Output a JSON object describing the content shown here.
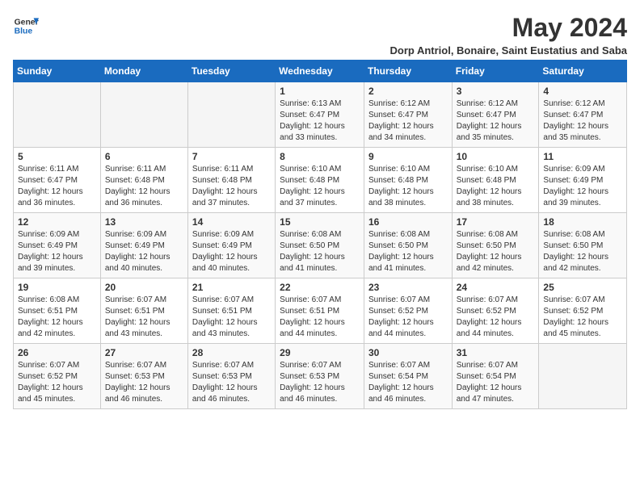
{
  "header": {
    "logo_line1": "General",
    "logo_line2": "Blue",
    "month_title": "May 2024",
    "subtitle": "Dorp Antriol, Bonaire, Saint Eustatius and Saba"
  },
  "days_of_week": [
    "Sunday",
    "Monday",
    "Tuesday",
    "Wednesday",
    "Thursday",
    "Friday",
    "Saturday"
  ],
  "weeks": [
    [
      {
        "day": "",
        "info": ""
      },
      {
        "day": "",
        "info": ""
      },
      {
        "day": "",
        "info": ""
      },
      {
        "day": "1",
        "info": "Sunrise: 6:13 AM\nSunset: 6:47 PM\nDaylight: 12 hours\nand 33 minutes."
      },
      {
        "day": "2",
        "info": "Sunrise: 6:12 AM\nSunset: 6:47 PM\nDaylight: 12 hours\nand 34 minutes."
      },
      {
        "day": "3",
        "info": "Sunrise: 6:12 AM\nSunset: 6:47 PM\nDaylight: 12 hours\nand 35 minutes."
      },
      {
        "day": "4",
        "info": "Sunrise: 6:12 AM\nSunset: 6:47 PM\nDaylight: 12 hours\nand 35 minutes."
      }
    ],
    [
      {
        "day": "5",
        "info": "Sunrise: 6:11 AM\nSunset: 6:47 PM\nDaylight: 12 hours\nand 36 minutes."
      },
      {
        "day": "6",
        "info": "Sunrise: 6:11 AM\nSunset: 6:48 PM\nDaylight: 12 hours\nand 36 minutes."
      },
      {
        "day": "7",
        "info": "Sunrise: 6:11 AM\nSunset: 6:48 PM\nDaylight: 12 hours\nand 37 minutes."
      },
      {
        "day": "8",
        "info": "Sunrise: 6:10 AM\nSunset: 6:48 PM\nDaylight: 12 hours\nand 37 minutes."
      },
      {
        "day": "9",
        "info": "Sunrise: 6:10 AM\nSunset: 6:48 PM\nDaylight: 12 hours\nand 38 minutes."
      },
      {
        "day": "10",
        "info": "Sunrise: 6:10 AM\nSunset: 6:48 PM\nDaylight: 12 hours\nand 38 minutes."
      },
      {
        "day": "11",
        "info": "Sunrise: 6:09 AM\nSunset: 6:49 PM\nDaylight: 12 hours\nand 39 minutes."
      }
    ],
    [
      {
        "day": "12",
        "info": "Sunrise: 6:09 AM\nSunset: 6:49 PM\nDaylight: 12 hours\nand 39 minutes."
      },
      {
        "day": "13",
        "info": "Sunrise: 6:09 AM\nSunset: 6:49 PM\nDaylight: 12 hours\nand 40 minutes."
      },
      {
        "day": "14",
        "info": "Sunrise: 6:09 AM\nSunset: 6:49 PM\nDaylight: 12 hours\nand 40 minutes."
      },
      {
        "day": "15",
        "info": "Sunrise: 6:08 AM\nSunset: 6:50 PM\nDaylight: 12 hours\nand 41 minutes."
      },
      {
        "day": "16",
        "info": "Sunrise: 6:08 AM\nSunset: 6:50 PM\nDaylight: 12 hours\nand 41 minutes."
      },
      {
        "day": "17",
        "info": "Sunrise: 6:08 AM\nSunset: 6:50 PM\nDaylight: 12 hours\nand 42 minutes."
      },
      {
        "day": "18",
        "info": "Sunrise: 6:08 AM\nSunset: 6:50 PM\nDaylight: 12 hours\nand 42 minutes."
      }
    ],
    [
      {
        "day": "19",
        "info": "Sunrise: 6:08 AM\nSunset: 6:51 PM\nDaylight: 12 hours\nand 42 minutes."
      },
      {
        "day": "20",
        "info": "Sunrise: 6:07 AM\nSunset: 6:51 PM\nDaylight: 12 hours\nand 43 minutes."
      },
      {
        "day": "21",
        "info": "Sunrise: 6:07 AM\nSunset: 6:51 PM\nDaylight: 12 hours\nand 43 minutes."
      },
      {
        "day": "22",
        "info": "Sunrise: 6:07 AM\nSunset: 6:51 PM\nDaylight: 12 hours\nand 44 minutes."
      },
      {
        "day": "23",
        "info": "Sunrise: 6:07 AM\nSunset: 6:52 PM\nDaylight: 12 hours\nand 44 minutes."
      },
      {
        "day": "24",
        "info": "Sunrise: 6:07 AM\nSunset: 6:52 PM\nDaylight: 12 hours\nand 44 minutes."
      },
      {
        "day": "25",
        "info": "Sunrise: 6:07 AM\nSunset: 6:52 PM\nDaylight: 12 hours\nand 45 minutes."
      }
    ],
    [
      {
        "day": "26",
        "info": "Sunrise: 6:07 AM\nSunset: 6:52 PM\nDaylight: 12 hours\nand 45 minutes."
      },
      {
        "day": "27",
        "info": "Sunrise: 6:07 AM\nSunset: 6:53 PM\nDaylight: 12 hours\nand 46 minutes."
      },
      {
        "day": "28",
        "info": "Sunrise: 6:07 AM\nSunset: 6:53 PM\nDaylight: 12 hours\nand 46 minutes."
      },
      {
        "day": "29",
        "info": "Sunrise: 6:07 AM\nSunset: 6:53 PM\nDaylight: 12 hours\nand 46 minutes."
      },
      {
        "day": "30",
        "info": "Sunrise: 6:07 AM\nSunset: 6:54 PM\nDaylight: 12 hours\nand 46 minutes."
      },
      {
        "day": "31",
        "info": "Sunrise: 6:07 AM\nSunset: 6:54 PM\nDaylight: 12 hours\nand 47 minutes."
      },
      {
        "day": "",
        "info": ""
      }
    ]
  ]
}
